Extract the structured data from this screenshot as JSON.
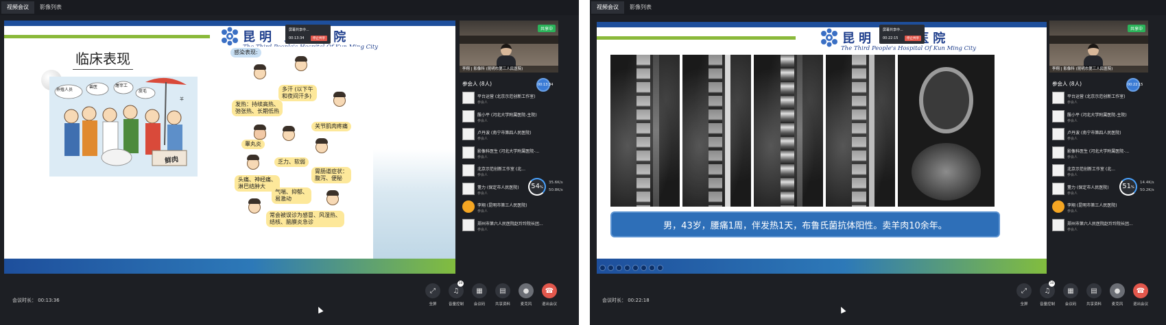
{
  "tabs": [
    "视频会议",
    "影像列表"
  ],
  "hospital": {
    "name_cn": "昆明 人民医院",
    "name_en": "The Third People's Hospital Of Kun Ming City"
  },
  "record_popup": {
    "title": "屏幕共享中...",
    "stop_label": "停止共享"
  },
  "self_video": {
    "name": "李翔 | 影像科 (昆明市第三人民医院)",
    "share_badge": "共享中"
  },
  "participants": {
    "header": "参会人 (8人)",
    "list": [
      {
        "name": "平台运营 (北京示范创新工作室)",
        "role": "参会人"
      },
      {
        "name": "殷小平 (河北大学附属医院-主院)",
        "role": "参会人"
      },
      {
        "name": "卢丹波 (南宁市第四人民医院)",
        "role": "参会人"
      },
      {
        "name": "影像科医生 (河北大学附属医院-...",
        "role": "参会人"
      },
      {
        "name": "北京示范创新工作室 (北...",
        "role": "参会人"
      },
      {
        "name": "董力 (保定市人民医院)",
        "role": "参会人"
      },
      {
        "name": "李翔 (昆明市第三人民医院)",
        "role": "参会人"
      },
      {
        "name": "郑州市第六人民医院赵玲玲院长团...",
        "role": "参会人"
      }
    ]
  },
  "controls": [
    {
      "name": "fullscreen",
      "label": "全屏",
      "icon": "fullscreen-icon",
      "glyph": "⤢"
    },
    {
      "name": "volume",
      "label": "音量控制",
      "icon": "speaker-icon",
      "glyph": "🔊",
      "badge": "10"
    },
    {
      "name": "minutes",
      "label": "会议码",
      "icon": "qr-icon",
      "glyph": "▦"
    },
    {
      "name": "share",
      "label": "共享资料",
      "icon": "document-icon",
      "glyph": "▤"
    },
    {
      "name": "mic",
      "label": "麦克风",
      "icon": "mic-icon",
      "glyph": "🎙"
    },
    {
      "name": "leave",
      "label": "退出会议",
      "icon": "phone-hangup-icon",
      "glyph": "☎"
    }
  ],
  "left": {
    "record_time": "00:13:34",
    "rec_dot": "00:13:34",
    "duration": "会议时长： 00:13:36",
    "slide_title": "临床表现",
    "panel_heading": "感染表现:",
    "panel_tags": [
      "多汗 (以下午\n和夜间汗多)",
      "发热：持续高热、\n弛张热、长期低热",
      "关节肌肉疼痛",
      "睾丸炎",
      "乏力、软弱",
      "头痛、神经痛、\n淋巴结肿大",
      "胃肠道症状：\n腹泻、便秘",
      "气喘、抑郁、\n易激动",
      "常会被误诊为感冒、风湿热、\n结核、脑膜炎急诊",
      "鲜肉"
    ],
    "cartoon_signs": [
      "养殖人员",
      "兽医",
      "屠宰工",
      "皮毛",
      "羊"
    ],
    "network": {
      "percent": "54",
      "unit": "%",
      "up": "35.6K/s",
      "down": "50.8K/s"
    }
  },
  "right": {
    "record_time": "00:22:15",
    "rec_dot": "00:22:15",
    "duration": "会议时长： 00:22:18",
    "caption": "男，43岁，腰痛1周，伴发热1天，布鲁氏菌抗体阳性。卖羊肉10余年。",
    "network": {
      "percent": "51",
      "unit": "%",
      "up": "14.4K/s",
      "down": "50.2K/s"
    }
  }
}
